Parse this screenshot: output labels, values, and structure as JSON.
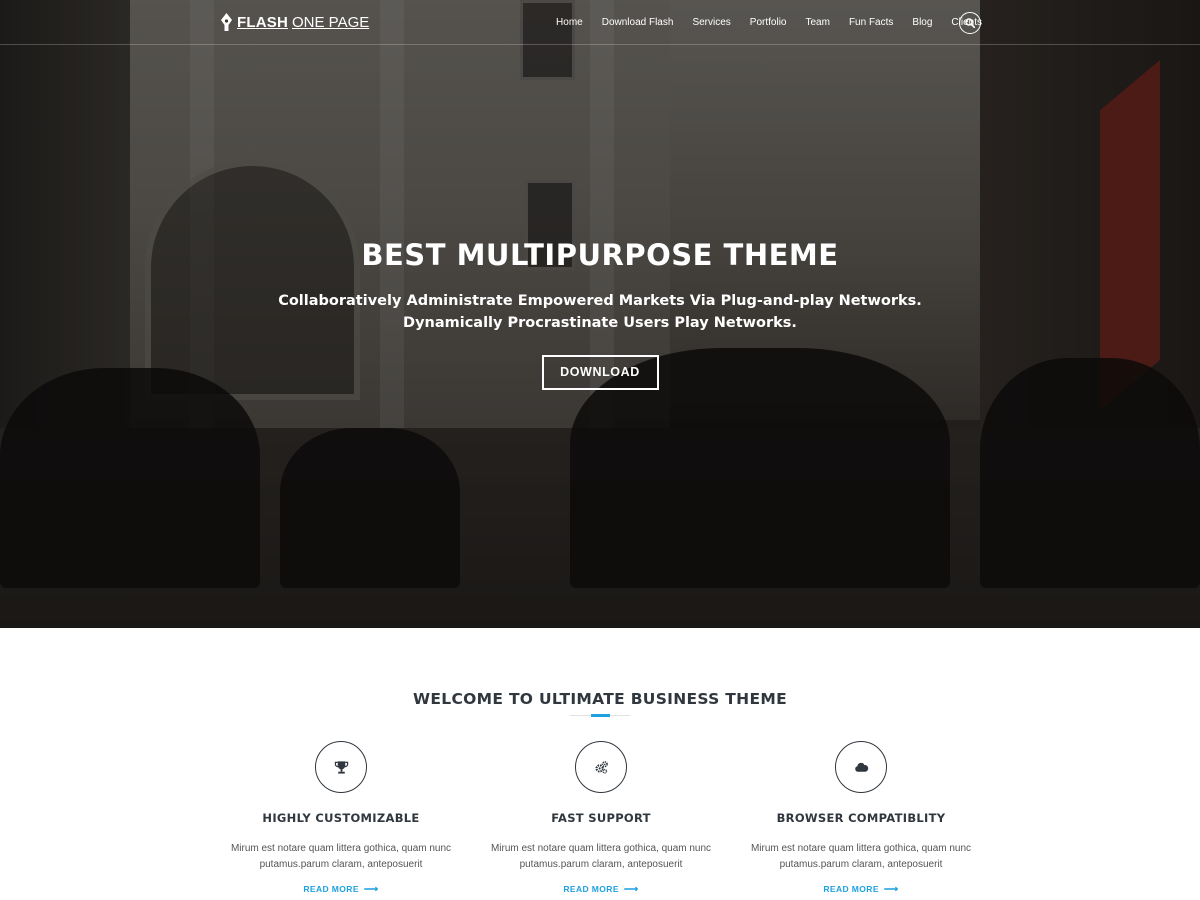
{
  "header": {
    "logo_bold": "FLASH",
    "logo_light": "ONE PAGE",
    "nav": [
      "Home",
      "Download Flash",
      "Services",
      "Portfolio",
      "Team",
      "Fun Facts",
      "Blog",
      "Clients"
    ],
    "search_icon": "search-icon"
  },
  "hero": {
    "title": "BEST MULTIPURPOSE THEME",
    "subtitle": "Collaboratively Administrate Empowered Markets Via Plug-and-play Networks. Dynamically Procrastinate Users Play Networks.",
    "button": "DOWNLOAD"
  },
  "welcome": {
    "title": "WELCOME TO ULTIMATE BUSINESS THEME",
    "accent_color": "#1fa0e0",
    "features": [
      {
        "icon": "trophy-icon",
        "title": "HIGHLY CUSTOMIZABLE",
        "text": "Mirum est notare quam littera gothica, quam nunc putamus.parum claram, anteposuerit",
        "link": "READ MORE"
      },
      {
        "icon": "gears-icon",
        "title": "FAST SUPPORT",
        "text": "Mirum est notare quam littera gothica, quam nunc putamus.parum claram, anteposuerit",
        "link": "READ MORE"
      },
      {
        "icon": "cloud-icon",
        "title": "BROWSER COMPATIBLITY",
        "text": "Mirum est notare quam littera gothica, quam nunc putamus.parum claram, anteposuerit",
        "link": "READ MORE"
      }
    ]
  }
}
